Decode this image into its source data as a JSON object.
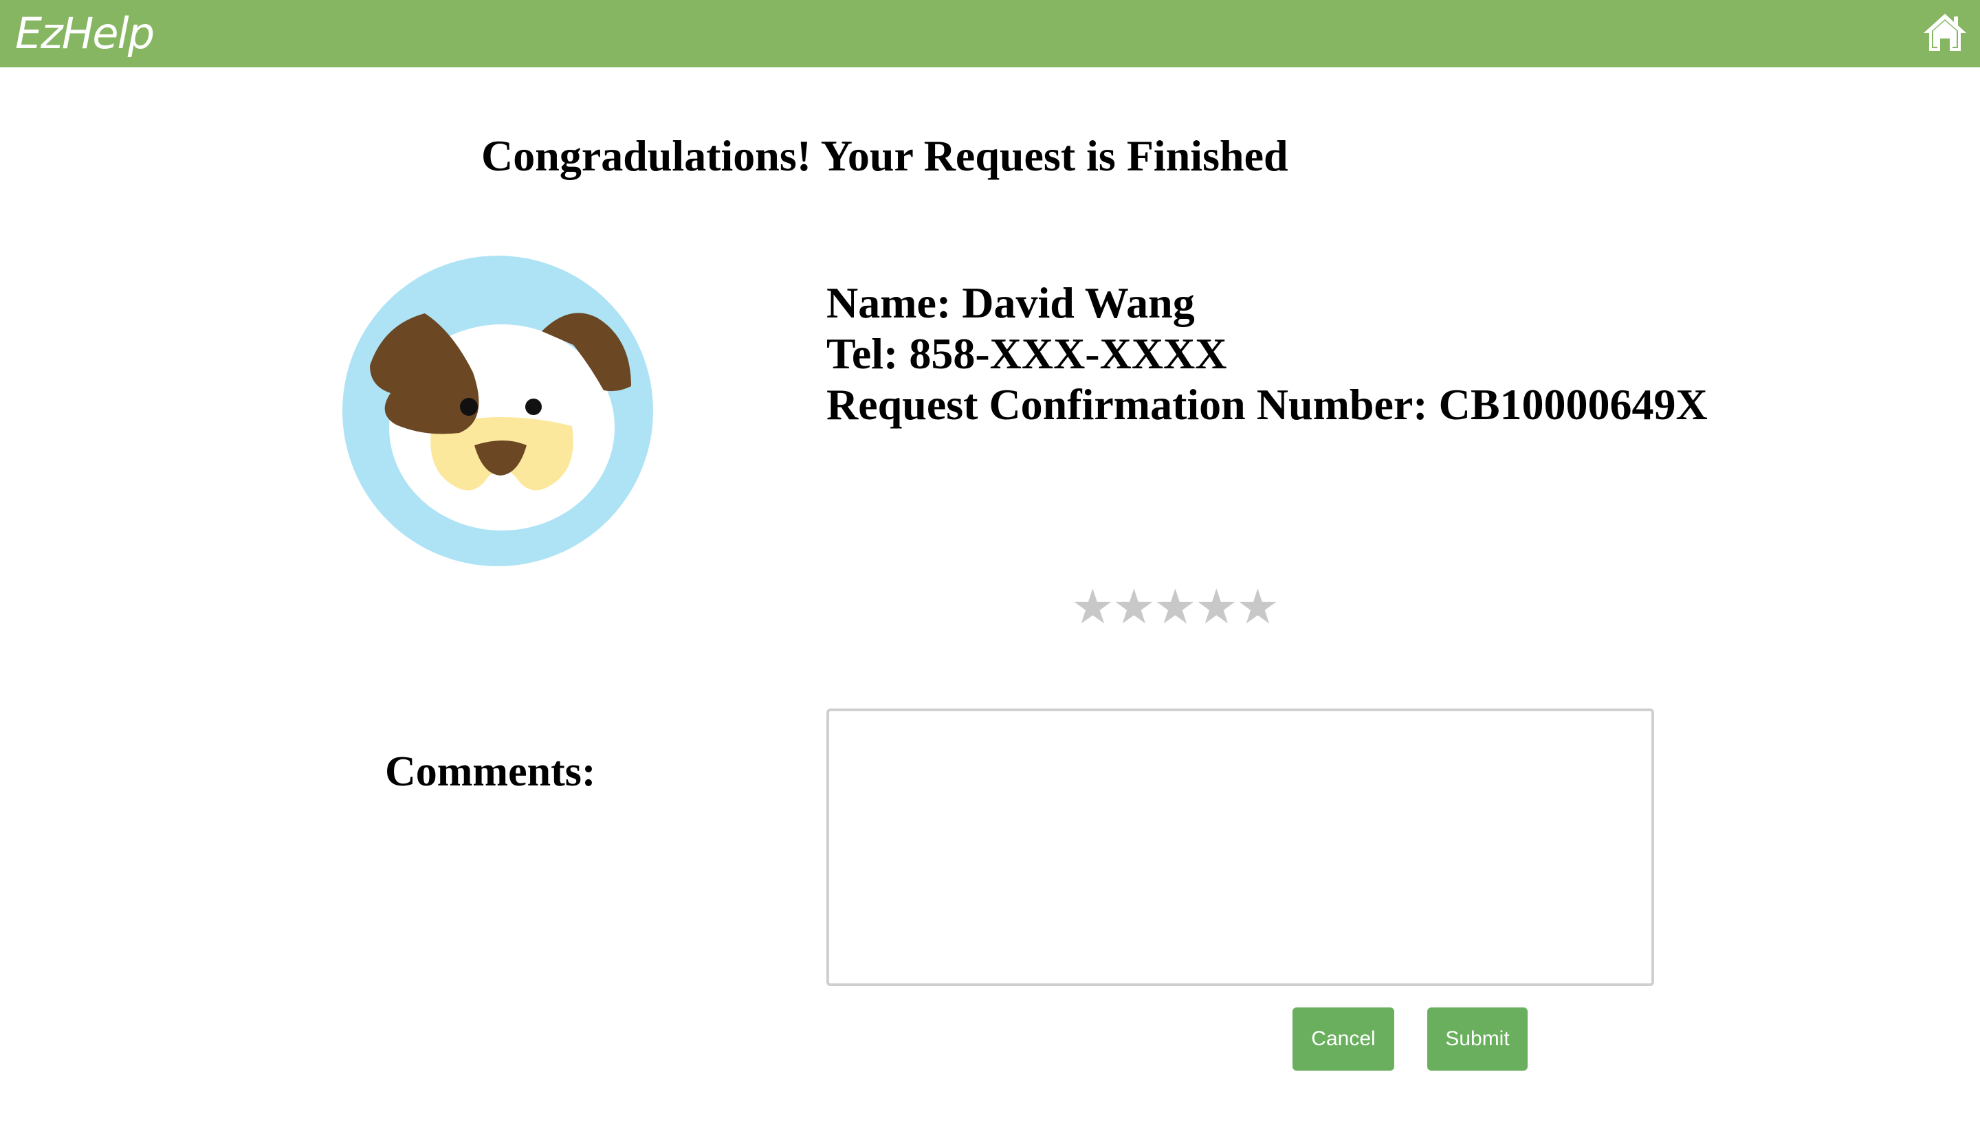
{
  "header": {
    "logo_text": "EzHelp",
    "home_icon": "home-icon",
    "bar_color": "#86b662"
  },
  "main": {
    "title": "Congradulations! Your Request is Finished",
    "avatar_icon": "dog-avatar",
    "info": {
      "name": "Name: David Wang",
      "tel": "Tel: 858-XXX-XXXX",
      "confirmation": "Request Confirmation Number: CB10000649X"
    },
    "rating": {
      "stars": [
        "★",
        "★",
        "★",
        "★",
        "★"
      ],
      "value": 0,
      "max": 5
    },
    "comments": {
      "label": "Comments:",
      "value": "",
      "placeholder": ""
    },
    "buttons": {
      "cancel_label": "Cancel",
      "submit_label": "Submit",
      "color": "#6aaf5e"
    }
  }
}
